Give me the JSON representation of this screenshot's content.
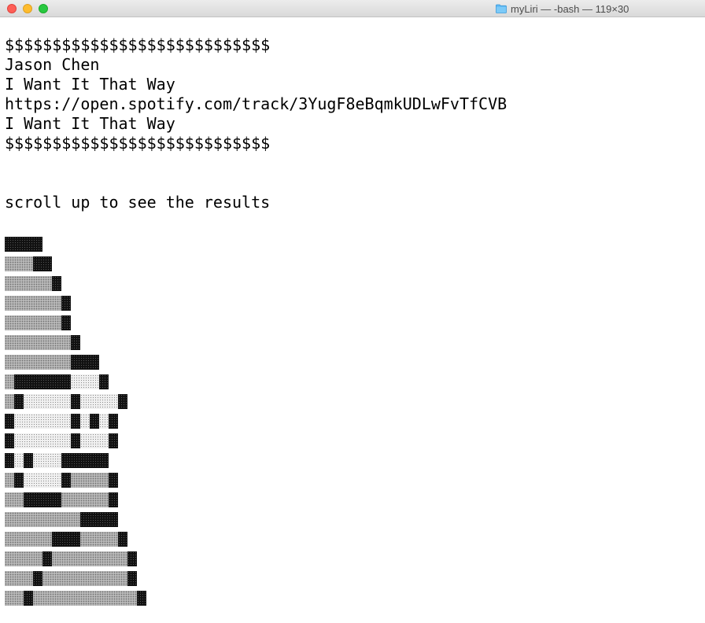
{
  "window": {
    "title": "myLiri — -bash — 119×30",
    "folder_icon": "folder-icon"
  },
  "terminal": {
    "lines": [
      "$$$$$$$$$$$$$$$$$$$$$$$$$$$$",
      "Jason Chen",
      "I Want It That Way",
      "https://open.spotify.com/track/3YugF8eBqmkUDLwFvTfCVB",
      "I Want It That Way",
      "$$$$$$$$$$$$$$$$$$$$$$$$$$$$",
      "",
      "",
      "scroll up to see the results"
    ]
  },
  "block_art": {
    "description_free_rows": [
      "DDDD",
      "MMMDD",
      "MMMMMD",
      "MMMMMMD",
      "MMMMMMD",
      "MMMMMMMD",
      "MMMMMMMDDD",
      "MDDDDDDLLLD",
      "MDLLLLLDLLLLD",
      "DLLLLLLDLDLD",
      "DLLLLLLDLLLD",
      "DLDLLLDDDDD",
      "MDLLLLDMMMMD",
      "MMDDDDMMMMMD",
      "MMMMMMMMDDDD",
      "MMMMMDDDMMMMD",
      "MMMMDMMMMMMMMD",
      "MMMDMMMMMMMMMD",
      "MMDMMMMMMMMMMMD"
    ],
    "colors": {
      "dark": "#111111",
      "medium": "#b9b9b9",
      "light": "#f0f0f0"
    }
  }
}
